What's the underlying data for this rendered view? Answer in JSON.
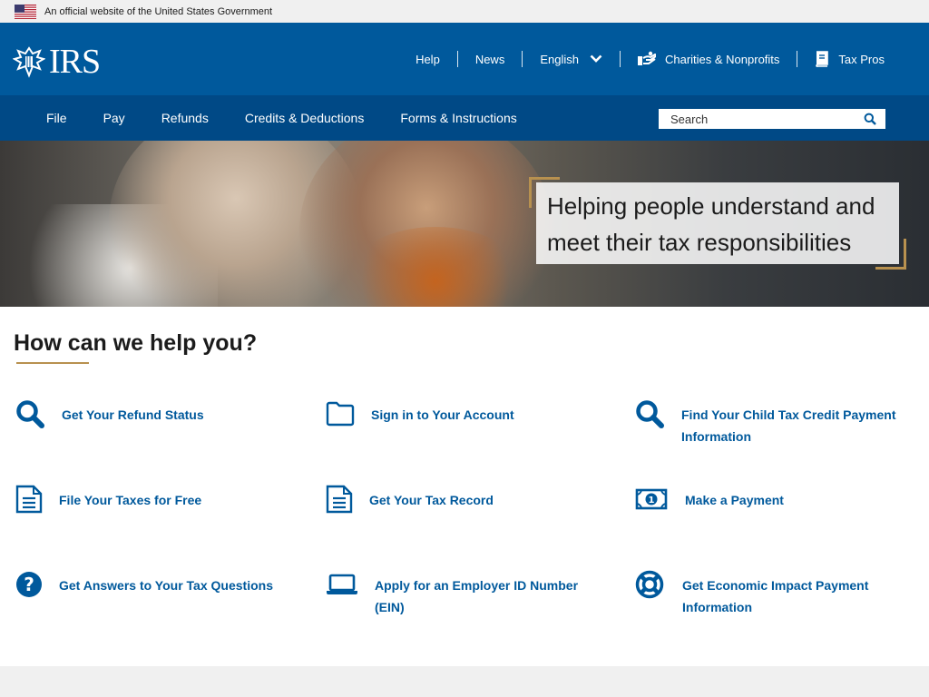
{
  "gov_banner": {
    "text": "An official website of the United States Government"
  },
  "header": {
    "logo_text": "IRS",
    "util_links": [
      {
        "label": "Help"
      },
      {
        "label": "News"
      },
      {
        "label": "English"
      },
      {
        "label": "Charities & Nonprofits"
      },
      {
        "label": "Tax Pros"
      }
    ]
  },
  "nav": {
    "items": [
      {
        "label": "File"
      },
      {
        "label": "Pay"
      },
      {
        "label": "Refunds"
      },
      {
        "label": "Credits & Deductions"
      },
      {
        "label": "Forms & Instructions"
      }
    ],
    "search_placeholder": "Search"
  },
  "hero": {
    "headline": "Helping people understand and meet their tax responsibilities"
  },
  "help": {
    "heading": "How can we help you?",
    "tiles": [
      {
        "label": "Get Your Refund Status",
        "icon": "search-icon"
      },
      {
        "label": "Sign in to Your Account",
        "icon": "folder-icon"
      },
      {
        "label": "Find Your Child Tax Credit Payment Information",
        "icon": "search-icon"
      },
      {
        "label": "File Your Taxes for Free",
        "icon": "document-icon"
      },
      {
        "label": "Get Your Tax Record",
        "icon": "document-icon"
      },
      {
        "label": "Make a Payment",
        "icon": "money-icon"
      },
      {
        "label": "Get Answers to Your Tax Questions",
        "icon": "question-icon"
      },
      {
        "label": "Apply for an Employer ID Number (EIN)",
        "icon": "laptop-icon"
      },
      {
        "label": "Get Economic Impact Payment Information",
        "icon": "lifebuoy-icon"
      }
    ]
  },
  "colors": {
    "header_blue": "#00599c",
    "nav_blue": "#004986",
    "link_blue": "#00599c",
    "accent_gold": "#b8914f",
    "banner_gray": "#f0f0f0"
  }
}
